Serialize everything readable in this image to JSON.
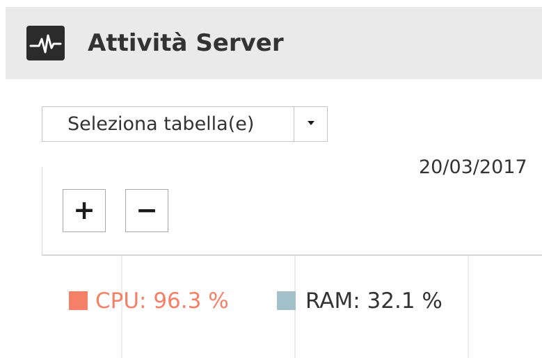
{
  "header": {
    "title": "Attività Server",
    "icon": "activity-monitor-icon"
  },
  "table_select": {
    "label": "Seleziona tabella(e)",
    "icon": "caret-down-icon"
  },
  "chart": {
    "date": "20/03/2017",
    "zoom_in_label": "+",
    "zoom_out_label": "−"
  },
  "legend": [
    {
      "text": "CPU: 96.3 %",
      "color": "#f58068",
      "text_color": "#f58068"
    },
    {
      "text": "RAM: 32.1 %",
      "color": "#a4c0cb",
      "text_color": "#333333"
    }
  ]
}
